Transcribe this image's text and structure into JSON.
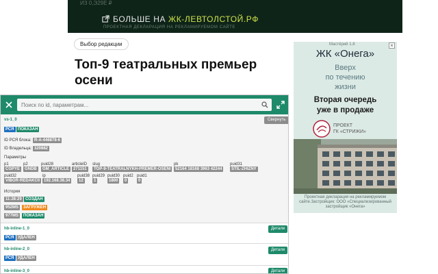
{
  "top_banner": {
    "faded_text": "ИЗ 0,Э29Е ₽",
    "prefix": "БОЛЬШЕ НА ",
    "link": "ЖК-ЛЕВТОЛСТОЙ.РФ",
    "note": "ПРОЕКТНАЯ ДЕКЛАРАЦИЯ НА РЕКЛАМИРУЕМОМ САЙТЕ"
  },
  "article": {
    "tag": "Выбор редакции",
    "title": "Топ-9 театральных премьер осени"
  },
  "side_ad": {
    "small": "Мастёрий 1.8",
    "title": "ЖК «Онега»",
    "sub": [
      "Вверх",
      "по течению",
      "жизни"
    ],
    "bold": [
      "Вторая очередь",
      "уже в продаже"
    ],
    "logo_text": [
      "ПРОЕКТ",
      "ГК «СТРИЖИ»"
    ],
    "disclaimer": [
      "Проектная декларация на рекламируемом",
      "сайте.Застройщик: ООО «Специализированный",
      "застройщик «Онега»"
    ],
    "close": "×"
  },
  "debug": {
    "search_placeholder": "Поиск по id, параметрам...",
    "block1": {
      "id": "vs-1_0",
      "tags": [
        "РСЯ",
        "ПОКАЗАН"
      ],
      "collapse_label": "Свернуть",
      "rsya_label": "ID РСЯ блока:",
      "rsya_value": "R-A-446878-6",
      "owner_label": "ID Владельца:",
      "owner_value": "320882",
      "params_label": "Параметры",
      "params_row1": [
        {
          "k": "p1",
          "v": "CGPYE"
        },
        {
          "k": "p2",
          "v": "GNDB"
        },
        {
          "k": "puid28",
          "v": "GM_ARTICLE"
        },
        {
          "k": "articleID",
          "v": "271151"
        },
        {
          "k": "slug",
          "v": "TOP-9-TEATRALNYKH-PREMER-OSENI"
        },
        {
          "k": "pk",
          "v": "52164 18168 3963 42244"
        },
        {
          "k": "puid31",
          "v": "STIL-ZHIZNY"
        }
      ],
      "params_row2": [
        {
          "k": "puid32",
          "v": "VIBOR-REDAKCII"
        },
        {
          "k": "ip",
          "v": "192.168.38.34"
        },
        {
          "k": "puid38",
          "v": "12"
        },
        {
          "k": "puid29",
          "v": "1"
        },
        {
          "k": "puid30",
          "v": "1800"
        },
        {
          "k": "puid2",
          "v": "0"
        },
        {
          "k": "puid1",
          "v": "0"
        }
      ],
      "history_label": "История",
      "history": [
        {
          "time": "11:28:29",
          "status": "СОЗДАН"
        },
        {
          "time": "952MS",
          "status": "ЗАГРУЖЕН"
        },
        {
          "time": "977MS",
          "status": "ПОКАЗАН"
        }
      ]
    },
    "blocks": [
      {
        "id": "hb-inline-1_0",
        "tags": [
          "РСЯ",
          "УДАЛЕН"
        ],
        "details_label": "Детали"
      },
      {
        "id": "hb-inline-2_0",
        "tags": [
          "РСЯ",
          "УДАЛЕН"
        ],
        "details_label": "Детали"
      },
      {
        "id": "hb-inline-3_0",
        "tags": [],
        "details_label": "Детали"
      }
    ]
  }
}
